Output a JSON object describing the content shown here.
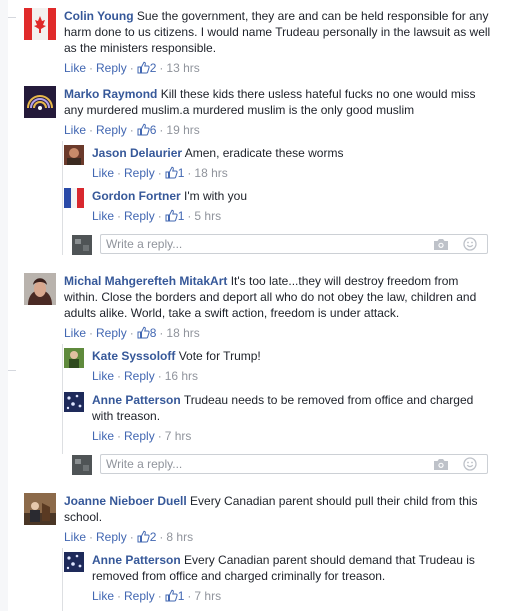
{
  "actions": {
    "like": "Like",
    "reply": "Reply",
    "sep": "·"
  },
  "reply_placeholder": "Write a reply...",
  "comments": [
    {
      "name": "Colin Young",
      "text": "Sue the government, they are and can be held responsible for any harm done to us citizens. I would name Trudeau personally in the lawsuit as well as the ministers responsible.",
      "likes": "2",
      "time": "13 hrs"
    },
    {
      "name": "Marko Raymond",
      "text": "Kill these kids there usless hateful fucks no one would miss any murdered muslim.a murdered muslim is the only good muslim",
      "likes": "6",
      "time": "19 hrs",
      "replies": [
        {
          "name": "Jason Delaurier",
          "text": "Amen, eradicate these worms",
          "likes": "1",
          "time": "18 hrs"
        },
        {
          "name": "Gordon Fortner",
          "text": "I'm with you",
          "likes": "1",
          "time": "5 hrs"
        }
      ]
    },
    {
      "name": "Michal Mahgerefteh MitakArt",
      "text": "It's too late...they will destroy freedom from within. Close the borders and deport all who do not obey the law, children and adults alike. World, take a swift action, freedom is under attack.",
      "likes": "8",
      "time": "18 hrs",
      "replies": [
        {
          "name": "Kate Syssoloff",
          "text": "Vote for Trump!",
          "time": "16 hrs"
        },
        {
          "name": "Anne Patterson",
          "text": "Trudeau needs to be removed from office and charged with treason.",
          "time": "7 hrs"
        }
      ]
    },
    {
      "name": "Joanne Nieboer Duell",
      "text": "Every Canadian parent should pull their child from this school.",
      "likes": "2",
      "time": "8 hrs",
      "replies": [
        {
          "name": "Anne Patterson",
          "text": "Every Canadian parent should demand that Trudeau is removed from office and charged criminally for treason.",
          "likes": "1",
          "time": "7 hrs"
        }
      ]
    }
  ],
  "colors": {
    "link": "#4267b2",
    "name": "#365899",
    "meta": "#90949c"
  }
}
